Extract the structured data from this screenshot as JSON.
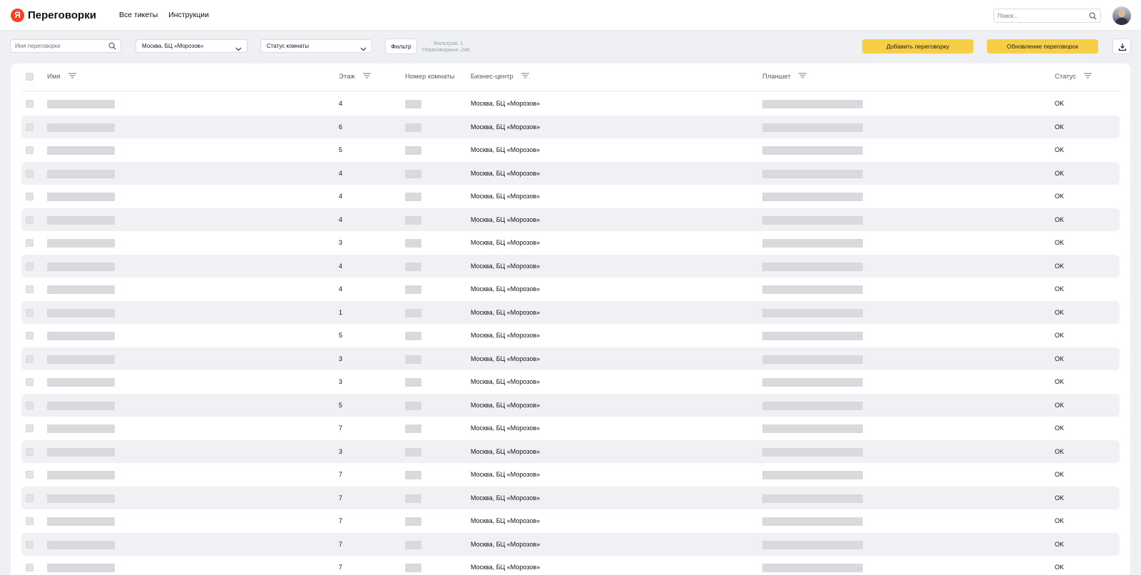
{
  "header": {
    "logo_letter": "Я",
    "app_title": "Переговорки",
    "nav": [
      "Все тикеты",
      "Инструкции"
    ],
    "search_placeholder": "Поиск..."
  },
  "toolbar": {
    "room_search_placeholder": "Имя переговорки",
    "location_select": "Москва, БЦ «Морозов»",
    "status_select": "Статус комнаты",
    "filter_button": "Фильтр",
    "filters_count": "Фильтров: 1",
    "rooms_count": "Переговорных: 246",
    "add_button": "Добавить переговорку",
    "update_button": "Обновление переговорок"
  },
  "table": {
    "columns": {
      "name": "Имя",
      "floor": "Этаж",
      "room_number": "Номер комнаты",
      "business_center": "Бизнес-центр",
      "tablet": "Планшет",
      "status": "Статус"
    },
    "rows": [
      {
        "floor": "4",
        "bc": "Москва, БЦ «Морозов»",
        "status": "OK"
      },
      {
        "floor": "6",
        "bc": "Москва, БЦ «Морозов»",
        "status": "OK"
      },
      {
        "floor": "5",
        "bc": "Москва, БЦ «Морозов»",
        "status": "OK"
      },
      {
        "floor": "4",
        "bc": "Москва, БЦ «Морозов»",
        "status": "OK"
      },
      {
        "floor": "4",
        "bc": "Москва, БЦ «Морозов»",
        "status": "OK"
      },
      {
        "floor": "4",
        "bc": "Москва, БЦ «Морозов»",
        "status": "OK"
      },
      {
        "floor": "3",
        "bc": "Москва, БЦ «Морозов»",
        "status": "OK"
      },
      {
        "floor": "4",
        "bc": "Москва, БЦ «Морозов»",
        "status": "OK"
      },
      {
        "floor": "4",
        "bc": "Москва, БЦ «Морозов»",
        "status": "OK"
      },
      {
        "floor": "1",
        "bc": "Москва, БЦ «Морозов»",
        "status": "OK"
      },
      {
        "floor": "5",
        "bc": "Москва, БЦ «Морозов»",
        "status": "OK"
      },
      {
        "floor": "3",
        "bc": "Москва, БЦ «Морозов»",
        "status": "OK"
      },
      {
        "floor": "3",
        "bc": "Москва, БЦ «Морозов»",
        "status": "OK"
      },
      {
        "floor": "5",
        "bc": "Москва, БЦ «Морозов»",
        "status": "OK"
      },
      {
        "floor": "7",
        "bc": "Москва, БЦ «Морозов»",
        "status": "OK"
      },
      {
        "floor": "3",
        "bc": "Москва, БЦ «Морозов»",
        "status": "OK"
      },
      {
        "floor": "7",
        "bc": "Москва, БЦ «Морозов»",
        "status": "OK"
      },
      {
        "floor": "7",
        "bc": "Москва, БЦ «Морозов»",
        "status": "OK"
      },
      {
        "floor": "7",
        "bc": "Москва, БЦ «Морозов»",
        "status": "OK"
      },
      {
        "floor": "7",
        "bc": "Москва, БЦ «Морозов»",
        "status": "OK"
      },
      {
        "floor": "7",
        "bc": "Москва, БЦ «Морозов»",
        "status": "OK"
      }
    ]
  },
  "icons": {
    "search": "search-icon",
    "chevron": "chevron-down-icon",
    "sort": "sort-icon",
    "export": "download-icon"
  },
  "colors": {
    "accent_yellow": "#f7cf46",
    "logo_red": "#fc3f1d",
    "page_bg": "#eef0f4",
    "row_alt": "#eff1f5"
  }
}
